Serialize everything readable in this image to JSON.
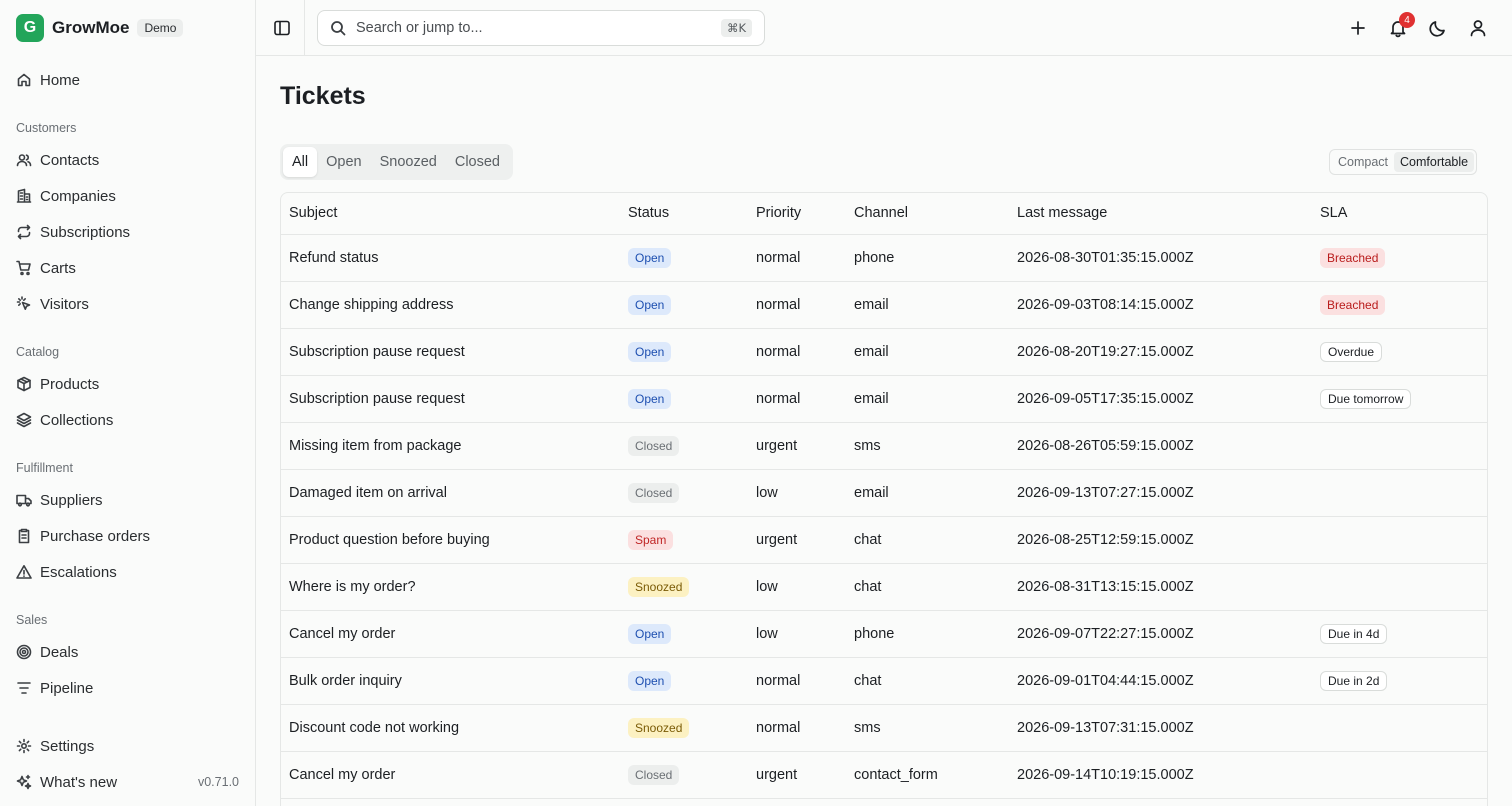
{
  "app": {
    "name": "GrowMoe",
    "logo_letter": "G",
    "env_badge": "Demo",
    "version": "v0.71.0"
  },
  "colors": {
    "brand": "#22a55a",
    "notification": "#e03131"
  },
  "nav": {
    "home": "Home",
    "customers_title": "Customers",
    "customers": [
      "Contacts",
      "Companies",
      "Subscriptions",
      "Carts",
      "Visitors"
    ],
    "catalog_title": "Catalog",
    "catalog": [
      "Products",
      "Collections"
    ],
    "fulfillment_title": "Fulfillment",
    "fulfillment": [
      "Suppliers",
      "Purchase orders",
      "Escalations"
    ],
    "sales_title": "Sales",
    "sales": [
      "Deals",
      "Pipeline"
    ],
    "settings": "Settings",
    "whats_new": "What's new"
  },
  "search": {
    "placeholder": "Search or jump to...",
    "shortcut": "⌘K"
  },
  "notifications": {
    "count": "4"
  },
  "page": {
    "title": "Tickets"
  },
  "tabs": [
    "All",
    "Open",
    "Snoozed",
    "Closed"
  ],
  "active_tab": "All",
  "density": {
    "options": [
      "Compact",
      "Comfortable"
    ],
    "selected": "Comfortable"
  },
  "table": {
    "columns": [
      "Subject",
      "Status",
      "Priority",
      "Channel",
      "Last message",
      "SLA"
    ],
    "rows": [
      [
        "Refund status",
        "Open",
        "normal",
        "phone",
        "2026-08-30T01:35:15.000Z",
        "Breached"
      ],
      [
        "Change shipping address",
        "Open",
        "normal",
        "email",
        "2026-09-03T08:14:15.000Z",
        "Breached"
      ],
      [
        "Subscription pause request",
        "Open",
        "normal",
        "email",
        "2026-08-20T19:27:15.000Z",
        "Overdue"
      ],
      [
        "Subscription pause request",
        "Open",
        "normal",
        "email",
        "2026-09-05T17:35:15.000Z",
        "Due tomorrow"
      ],
      [
        "Missing item from package",
        "Closed",
        "urgent",
        "sms",
        "2026-08-26T05:59:15.000Z",
        ""
      ],
      [
        "Damaged item on arrival",
        "Closed",
        "low",
        "email",
        "2026-09-13T07:27:15.000Z",
        ""
      ],
      [
        "Product question before buying",
        "Spam",
        "urgent",
        "chat",
        "2026-08-25T12:59:15.000Z",
        ""
      ],
      [
        "Where is my order?",
        "Snoozed",
        "low",
        "chat",
        "2026-08-31T13:15:15.000Z",
        ""
      ],
      [
        "Cancel my order",
        "Open",
        "low",
        "phone",
        "2026-09-07T22:27:15.000Z",
        "Due in 4d"
      ],
      [
        "Bulk order inquiry",
        "Open",
        "normal",
        "chat",
        "2026-09-01T04:44:15.000Z",
        "Due in 2d"
      ],
      [
        "Discount code not working",
        "Snoozed",
        "normal",
        "sms",
        "2026-09-13T07:31:15.000Z",
        ""
      ],
      [
        "Cancel my order",
        "Closed",
        "urgent",
        "contact_form",
        "2026-09-14T10:19:15.000Z",
        ""
      ]
    ]
  }
}
